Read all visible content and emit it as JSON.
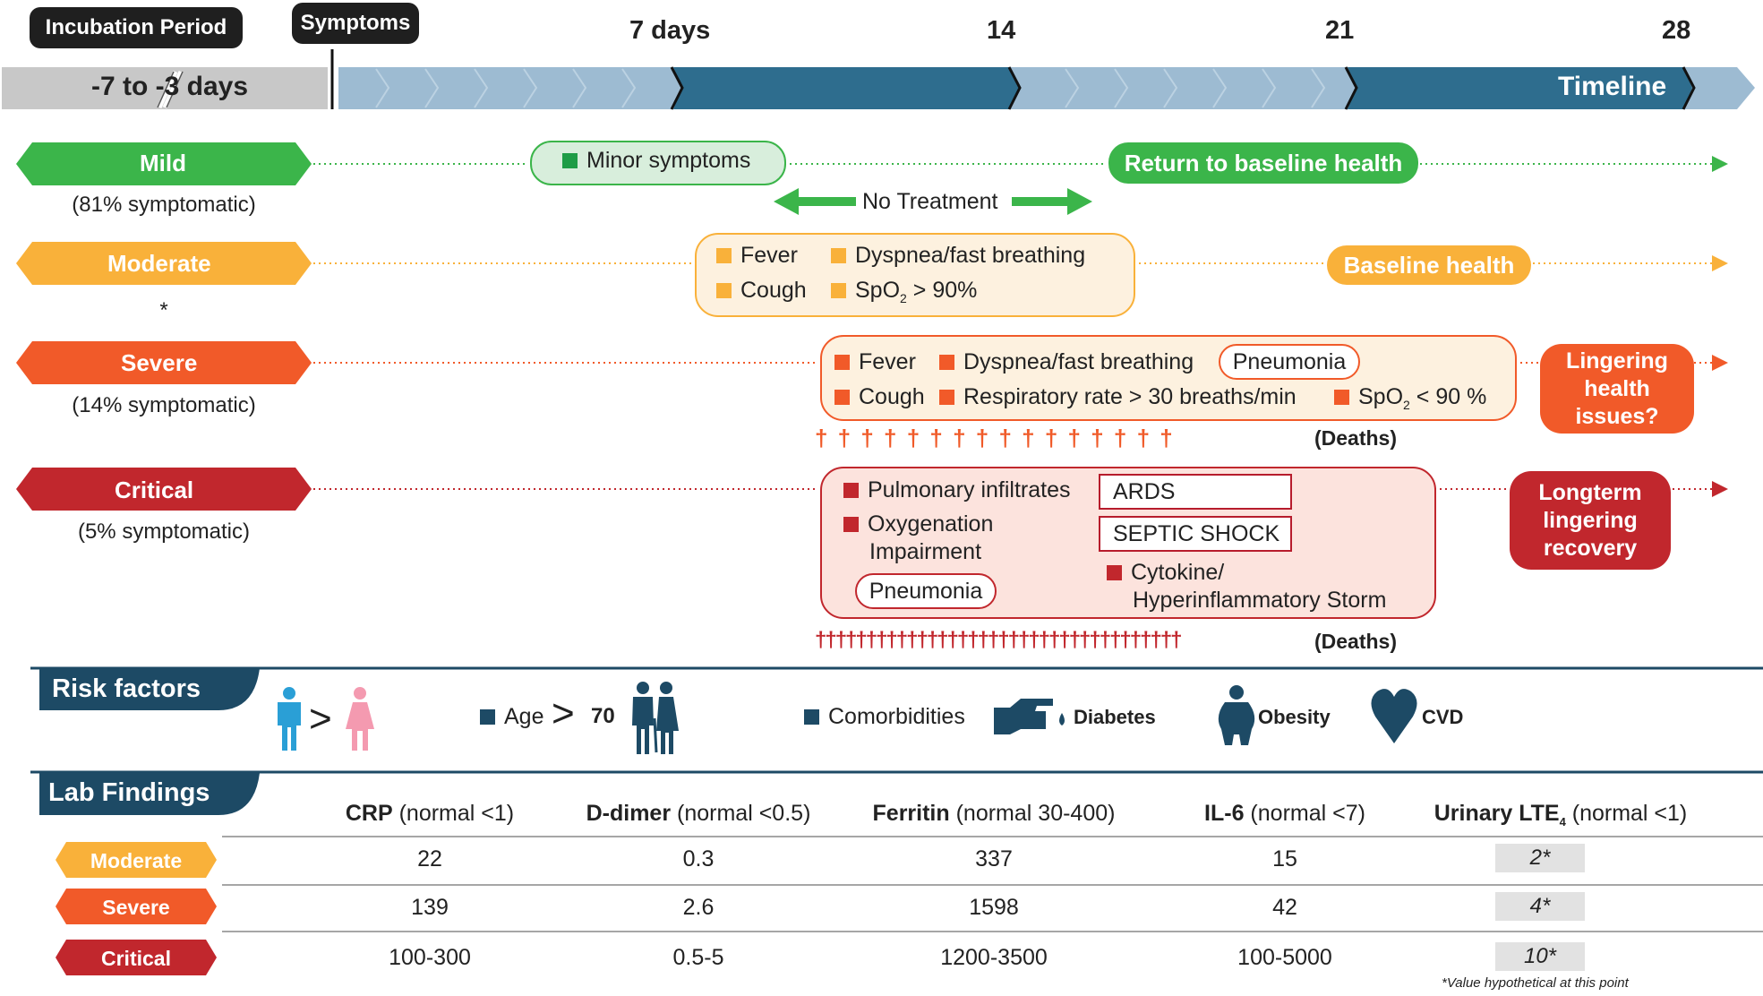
{
  "timeline": {
    "incubation_label": "Incubation Period",
    "symptoms_label": "Symptoms",
    "incubation_range": "-7 to -3 days",
    "day7": "7 days",
    "day14": "14",
    "day21": "21",
    "day28": "28",
    "timeline_label": "Timeline"
  },
  "mild": {
    "label": "Mild",
    "sub": "(81% symptomatic)",
    "minor": "Minor symptoms",
    "no_treatment": "No Treatment",
    "return": "Return to baseline health"
  },
  "moderate": {
    "label": "Moderate",
    "sub": "*",
    "fever": "Fever",
    "dyspnea": "Dyspnea/fast breathing",
    "cough": "Cough",
    "spo2_prefix": "SpO",
    "spo2_sub": "2",
    "spo2_suffix": " > 90%",
    "baseline": "Baseline health"
  },
  "severe": {
    "label": "Severe",
    "sub": "(14% symptomatic)",
    "fever": "Fever",
    "dyspnea": "Dyspnea/fast breathing",
    "pneumonia": "Pneumonia",
    "cough": "Cough",
    "resp": "Respiratory rate > 30 breaths/min",
    "spo2_prefix": "SpO",
    "spo2_sub": "2",
    "spo2_suffix": " < 90 %",
    "daggers": "† † † † † † † † † † † † † † † †",
    "deaths": "(Deaths)",
    "lingering": [
      "Lingering",
      "health",
      "issues?"
    ]
  },
  "critical": {
    "label": "Critical",
    "sub": "(5% symptomatic)",
    "infiltrates": "Pulmonary infiltrates",
    "oxygenation_1": "Oxygenation",
    "oxygenation_2": "Impairment",
    "pneumonia": "Pneumonia",
    "ards": "ARDS",
    "septic": "SEPTIC SHOCK",
    "cytokine_1": "Cytokine/",
    "cytokine_2": "Hyperinflammatory Storm",
    "daggers": "††††††††††††††††††††††††††††††††††††",
    "deaths": "(Deaths)",
    "longterm": [
      "Longterm",
      "lingering",
      "recovery"
    ]
  },
  "risk": {
    "title": "Risk factors",
    "gt": ">",
    "age_label": "Age",
    "age_gt": ">",
    "age_value": "70",
    "comorbidities": "Comorbidities",
    "diabetes": "Diabetes",
    "obesity": "Obesity",
    "cvd": "CVD"
  },
  "lab": {
    "title": "Lab Findings",
    "headers": [
      {
        "bold": "CRP",
        "normal": " (normal <1)"
      },
      {
        "bold": "D-dimer",
        "normal": " (normal <0.5)"
      },
      {
        "bold": "Ferritin",
        "normal": " (normal 30-400)"
      },
      {
        "bold": "IL-6",
        "normal": " (normal <7)"
      },
      {
        "bold": "Urinary LTE",
        "sub": "4",
        "normal": " (normal <1)"
      }
    ],
    "rows": [
      {
        "label": "Moderate",
        "values": [
          "22",
          "0.3",
          "337",
          "15",
          "2*"
        ]
      },
      {
        "label": "Severe",
        "values": [
          "139",
          "2.6",
          "1598",
          "42",
          "4*"
        ]
      },
      {
        "label": "Critical",
        "values": [
          "100-300",
          "0.5-5",
          "1200-3500",
          "100-5000",
          "10*"
        ]
      }
    ],
    "footnote": "*Value hypothetical at this point"
  },
  "colors": {
    "mild": "#3bb54a",
    "moderate": "#f9b13a",
    "severe": "#f15a29",
    "critical": "#c1272d",
    "timeline_light": "#9dbbd2",
    "timeline_dark": "#2e6d8e",
    "navy": "#1d4a65"
  }
}
